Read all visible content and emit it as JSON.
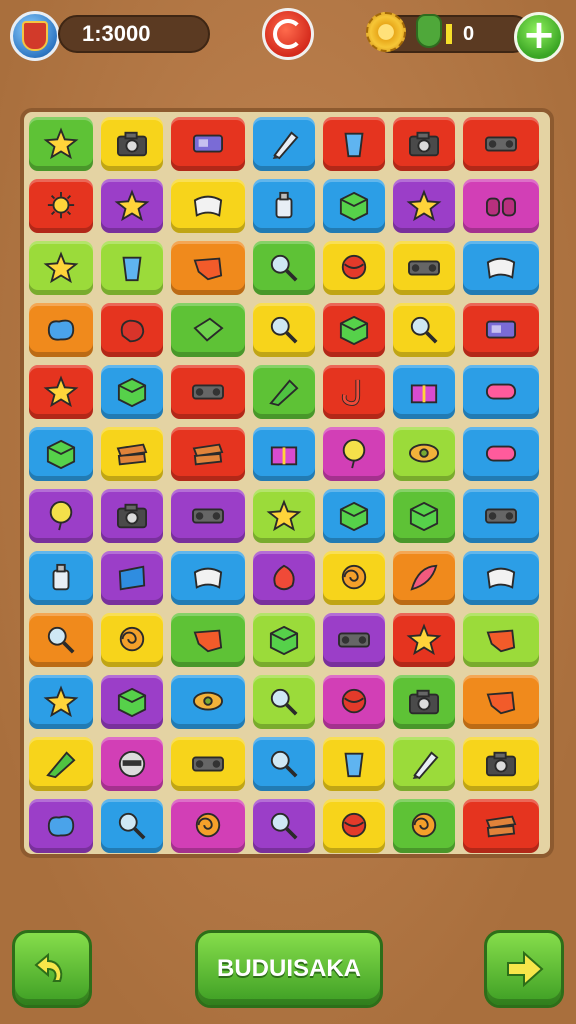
{
  "header": {
    "timer": "1:3000",
    "currency_count": "0"
  },
  "colors": {
    "green": "#5ec236",
    "red": "#e5341f",
    "yellow": "#f7d41b",
    "blue": "#2c9ee6",
    "purple": "#9b3ec8",
    "lime": "#9bdb3a",
    "orange": "#f08a1c",
    "magenta": "#d23fb6",
    "gold": "#f2b51a",
    "teal": "#1eb0c8"
  },
  "board": {
    "rows": [
      [
        {
          "c": "green",
          "i": "star"
        },
        {
          "c": "yellow",
          "i": "camera"
        },
        {
          "c": "red",
          "i": "block"
        },
        {
          "c": "blue",
          "i": "pen"
        },
        {
          "c": "red",
          "i": "cup"
        },
        {
          "c": "red",
          "i": "camera"
        },
        {
          "c": "red",
          "i": "speaker"
        }
      ],
      [
        {
          "c": "red",
          "i": "sun"
        },
        {
          "c": "purple",
          "i": "star"
        },
        {
          "c": "yellow",
          "i": "tape"
        },
        {
          "c": "blue",
          "i": "bottle"
        },
        {
          "c": "blue",
          "i": "cube"
        },
        {
          "c": "purple",
          "i": "star"
        },
        {
          "c": "magenta",
          "i": "binoculars"
        }
      ],
      [
        {
          "c": "lime",
          "i": "star"
        },
        {
          "c": "lime",
          "i": "cup"
        },
        {
          "c": "orange",
          "i": "scarf"
        },
        {
          "c": "green",
          "i": "magnifier"
        },
        {
          "c": "yellow",
          "i": "ball"
        },
        {
          "c": "yellow",
          "i": "speaker"
        },
        {
          "c": "blue",
          "i": "tape"
        }
      ],
      [
        {
          "c": "orange",
          "i": "blob"
        },
        {
          "c": "red",
          "i": "glove"
        },
        {
          "c": "green",
          "i": "pillow"
        },
        {
          "c": "yellow",
          "i": "magnifier"
        },
        {
          "c": "red",
          "i": "cube"
        },
        {
          "c": "yellow",
          "i": "magnifier"
        },
        {
          "c": "red",
          "i": "block"
        }
      ],
      [
        {
          "c": "red",
          "i": "star"
        },
        {
          "c": "blue",
          "i": "cube"
        },
        {
          "c": "red",
          "i": "speaker"
        },
        {
          "c": "green",
          "i": "cone"
        },
        {
          "c": "red",
          "i": "hook"
        },
        {
          "c": "blue",
          "i": "gift"
        },
        {
          "c": "blue",
          "i": "tube"
        }
      ],
      [
        {
          "c": "blue",
          "i": "cube"
        },
        {
          "c": "yellow",
          "i": "planks"
        },
        {
          "c": "red",
          "i": "planks"
        },
        {
          "c": "blue",
          "i": "gift"
        },
        {
          "c": "magenta",
          "i": "balloon"
        },
        {
          "c": "lime",
          "i": "eye"
        },
        {
          "c": "blue",
          "i": "tube"
        }
      ],
      [
        {
          "c": "purple",
          "i": "balloon"
        },
        {
          "c": "purple",
          "i": "camera"
        },
        {
          "c": "purple",
          "i": "speaker"
        },
        {
          "c": "lime",
          "i": "star"
        },
        {
          "c": "blue",
          "i": "cube"
        },
        {
          "c": "green",
          "i": "cube"
        },
        {
          "c": "blue",
          "i": "speaker"
        }
      ],
      [
        {
          "c": "blue",
          "i": "bottle"
        },
        {
          "c": "purple",
          "i": "card"
        },
        {
          "c": "blue",
          "i": "tape"
        },
        {
          "c": "purple",
          "i": "shell"
        },
        {
          "c": "yellow",
          "i": "swirl"
        },
        {
          "c": "orange",
          "i": "feather"
        },
        {
          "c": "blue",
          "i": "tape"
        }
      ],
      [
        {
          "c": "orange",
          "i": "magnifier"
        },
        {
          "c": "yellow",
          "i": "swirl"
        },
        {
          "c": "green",
          "i": "scarf"
        },
        {
          "c": "lime",
          "i": "cube"
        },
        {
          "c": "purple",
          "i": "speaker"
        },
        {
          "c": "red",
          "i": "star"
        },
        {
          "c": "lime",
          "i": "scarf"
        }
      ],
      [
        {
          "c": "blue",
          "i": "star"
        },
        {
          "c": "purple",
          "i": "cube"
        },
        {
          "c": "blue",
          "i": "eye"
        },
        {
          "c": "lime",
          "i": "magnifier"
        },
        {
          "c": "magenta",
          "i": "ball"
        },
        {
          "c": "green",
          "i": "camera"
        },
        {
          "c": "orange",
          "i": "scarf"
        }
      ],
      [
        {
          "c": "yellow",
          "i": "cone"
        },
        {
          "c": "magenta",
          "i": "helmet"
        },
        {
          "c": "yellow",
          "i": "speaker"
        },
        {
          "c": "blue",
          "i": "magnifier"
        },
        {
          "c": "yellow",
          "i": "cup"
        },
        {
          "c": "lime",
          "i": "pen"
        },
        {
          "c": "yellow",
          "i": "camera"
        }
      ],
      [
        {
          "c": "purple",
          "i": "blob"
        },
        {
          "c": "blue",
          "i": "magnifier"
        },
        {
          "c": "magenta",
          "i": "swirl"
        },
        {
          "c": "purple",
          "i": "magnifier"
        },
        {
          "c": "yellow",
          "i": "ball"
        },
        {
          "c": "green",
          "i": "swirl"
        },
        {
          "c": "red",
          "i": "planks"
        }
      ]
    ]
  },
  "footer": {
    "main_label": "BUDUISAKA"
  }
}
